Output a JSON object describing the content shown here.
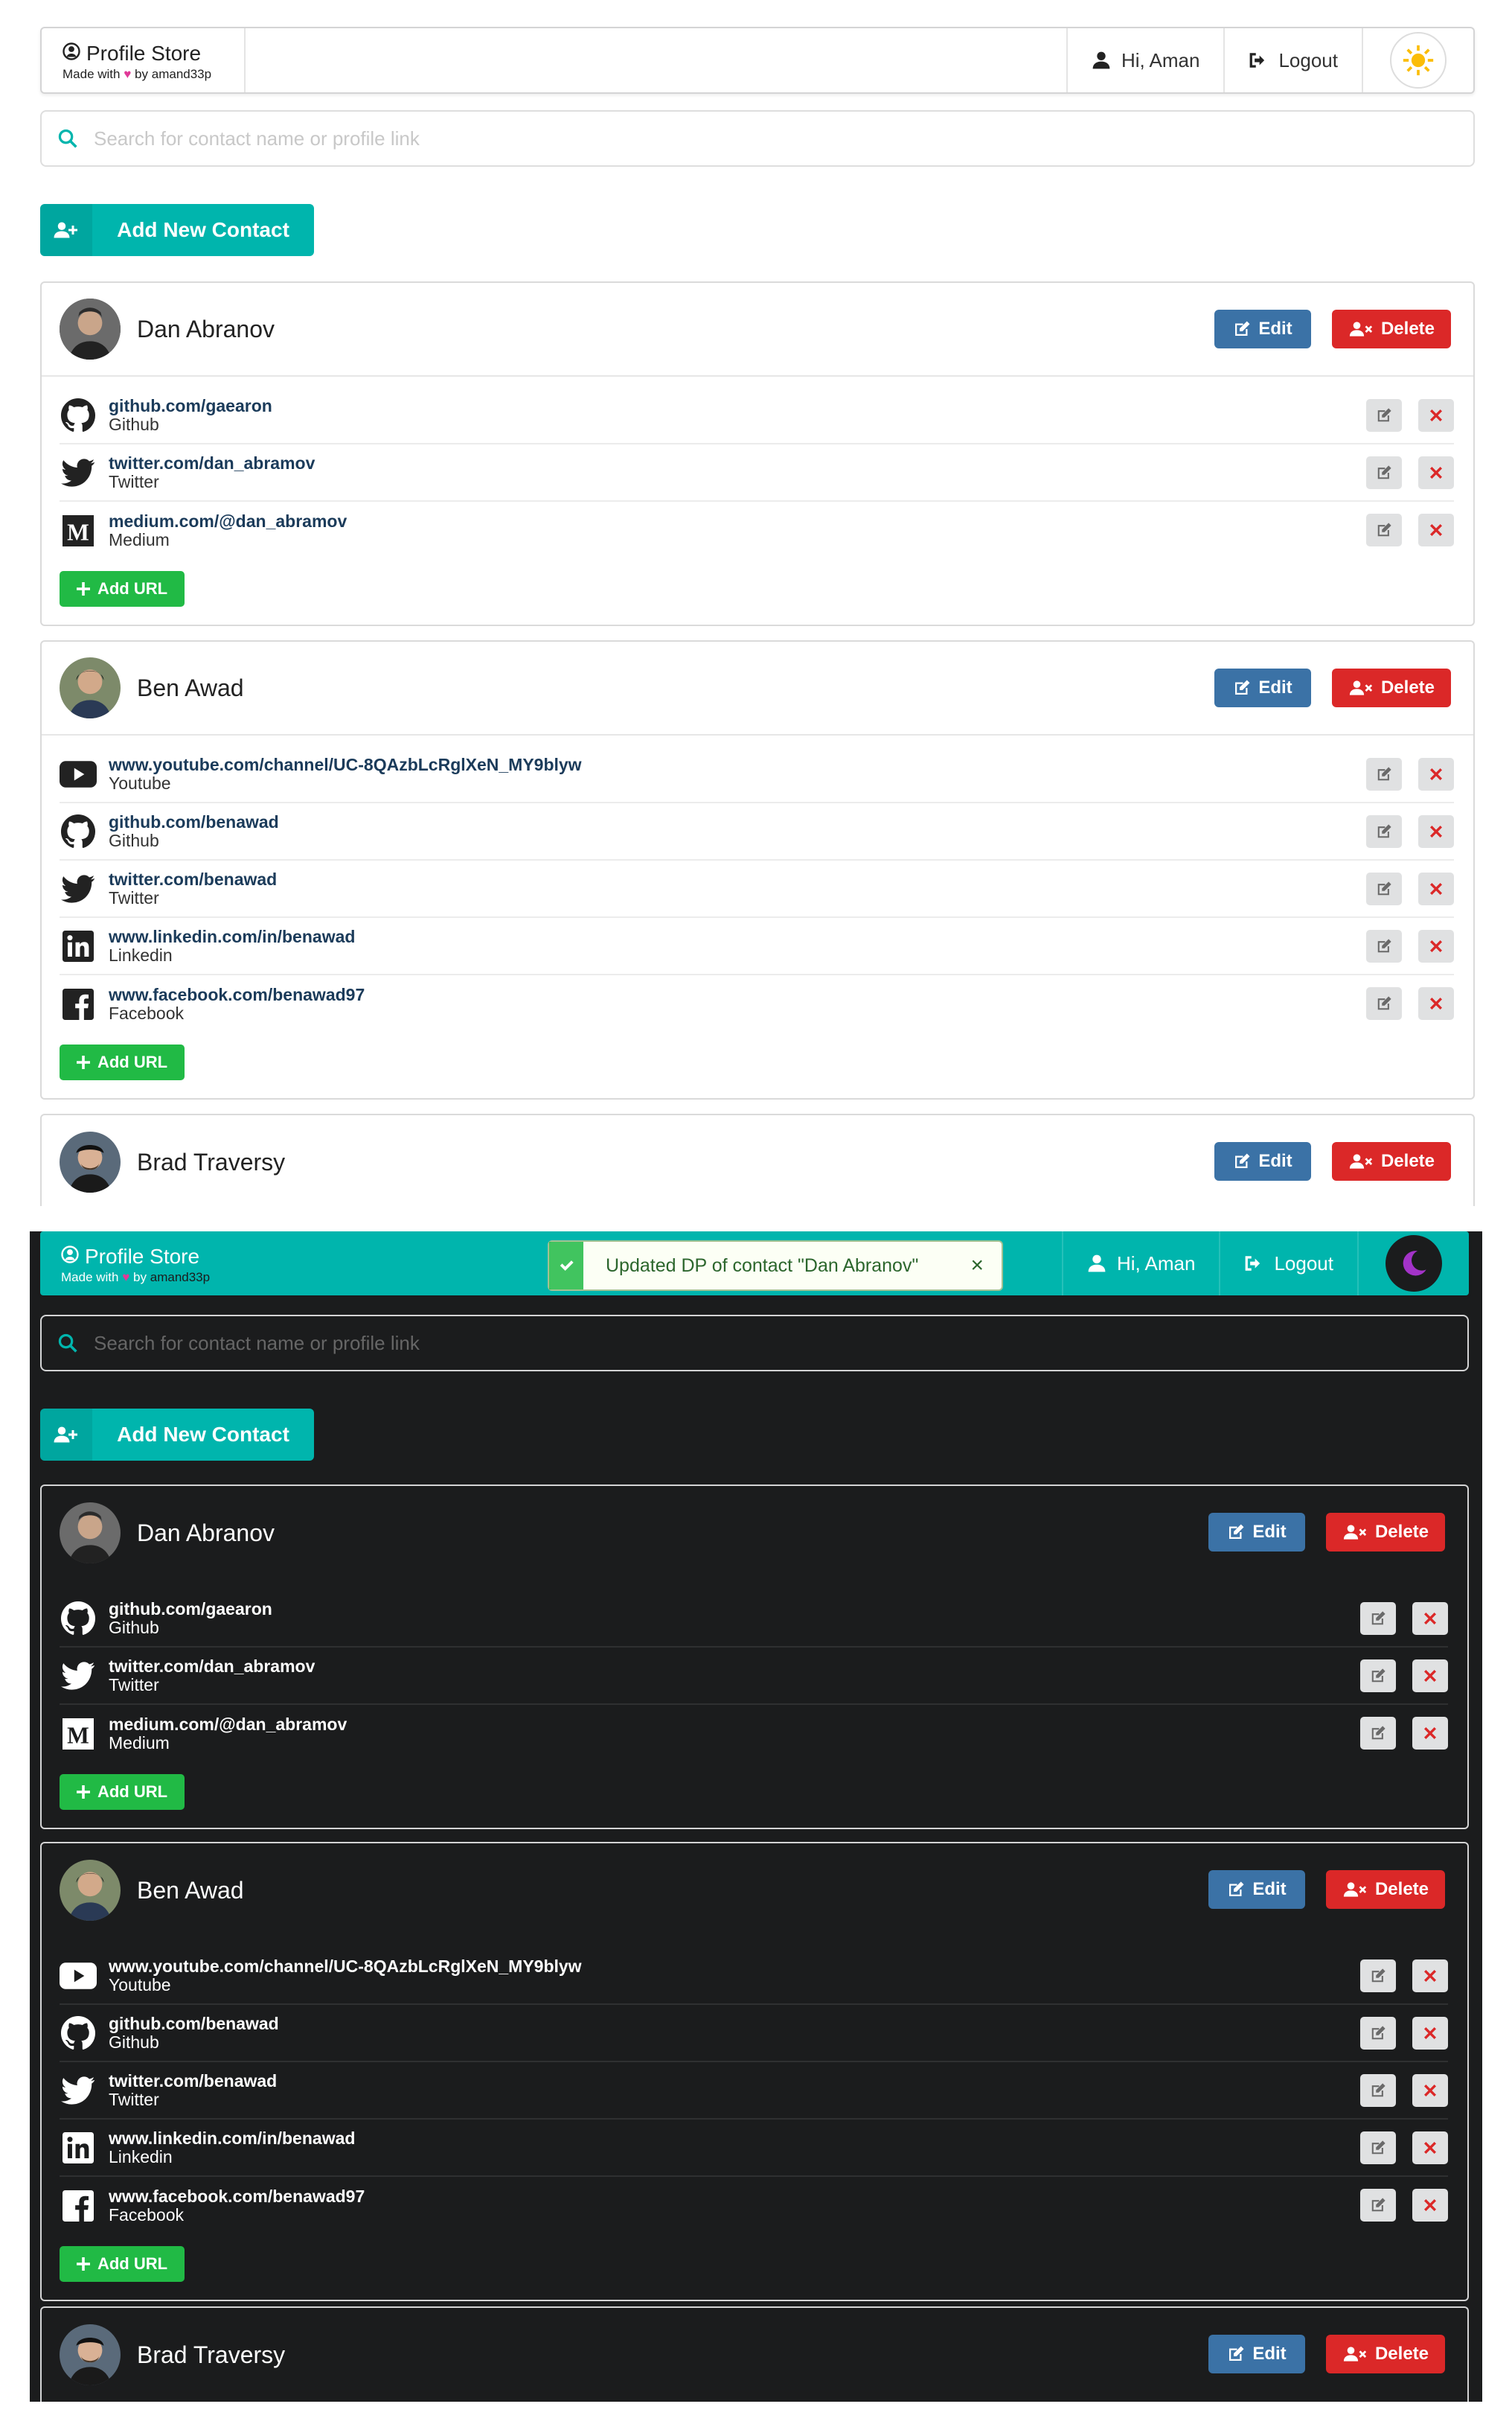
{
  "brand": {
    "title": "Profile Store",
    "made_with": "Made with",
    "by": "by",
    "author": "amand33p"
  },
  "nav": {
    "greeting": "Hi, Aman",
    "logout": "Logout"
  },
  "search": {
    "placeholder": "Search for contact name or profile link"
  },
  "actions": {
    "add_contact": "Add New Contact",
    "edit": "Edit",
    "delete": "Delete",
    "add_url": "Add URL"
  },
  "toast": {
    "message": "Updated DP of contact \"Dan Abranov\"",
    "close": "×"
  },
  "colors": {
    "teal": "#00b5ad",
    "edit": "#3b72a6",
    "delete": "#db2828",
    "add_url": "#21ba45",
    "dark_bg": "#1b1c1d"
  },
  "contacts": [
    {
      "name": "Dan Abranov",
      "links": [
        {
          "url": "github.com/gaearon",
          "site": "Github",
          "icon": "github-icon"
        },
        {
          "url": "twitter.com/dan_abramov",
          "site": "Twitter",
          "icon": "twitter-icon"
        },
        {
          "url": "medium.com/@dan_abramov",
          "site": "Medium",
          "icon": "medium-icon"
        }
      ]
    },
    {
      "name": "Ben Awad",
      "links": [
        {
          "url": "www.youtube.com/channel/UC-8QAzbLcRglXeN_MY9blyw",
          "site": "Youtube",
          "icon": "youtube-icon"
        },
        {
          "url": "github.com/benawad",
          "site": "Github",
          "icon": "github-icon"
        },
        {
          "url": "twitter.com/benawad",
          "site": "Twitter",
          "icon": "twitter-icon"
        },
        {
          "url": "www.linkedin.com/in/benawad",
          "site": "Linkedin",
          "icon": "linkedin-icon"
        },
        {
          "url": "www.facebook.com/benawad97",
          "site": "Facebook",
          "icon": "facebook-icon"
        }
      ]
    },
    {
      "name": "Brad Traversy",
      "links": []
    }
  ]
}
